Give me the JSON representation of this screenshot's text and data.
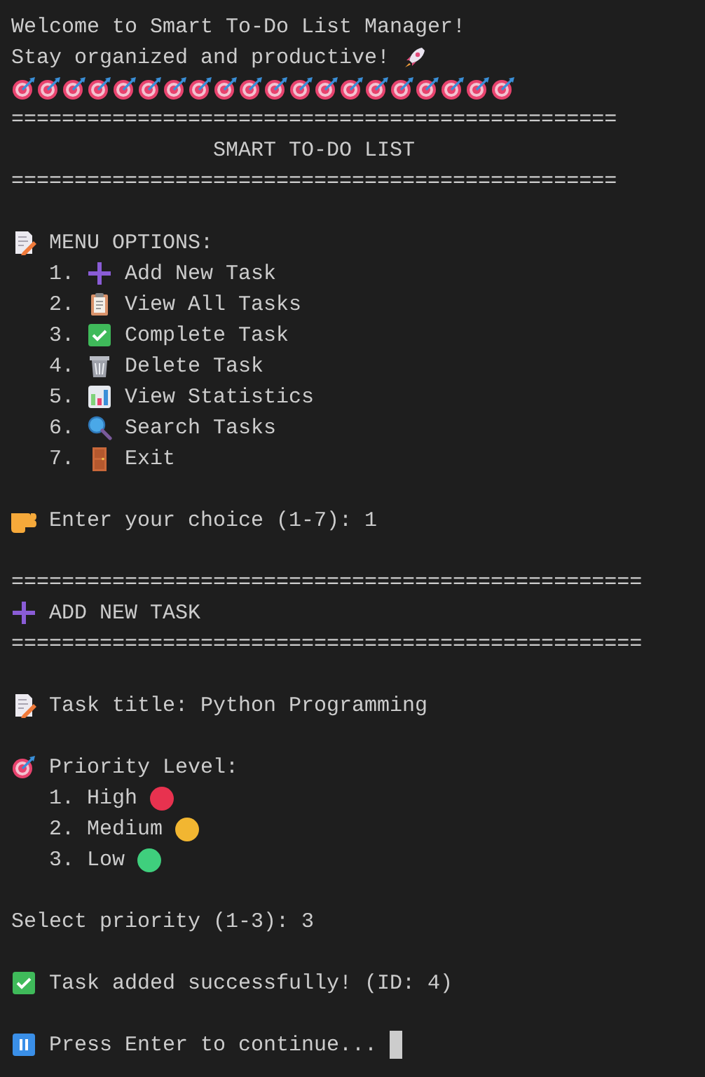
{
  "lines": [
    {
      "kind": "text",
      "text": "Welcome to Smart To-Do List Manager!"
    },
    {
      "kind": "text",
      "text": "Stay organized and productive!",
      "trail": {
        "kind": "rocket"
      }
    },
    {
      "kind": "icons",
      "icons": [
        {
          "kind": "target"
        },
        {
          "kind": "target"
        },
        {
          "kind": "target"
        },
        {
          "kind": "target"
        },
        {
          "kind": "target"
        },
        {
          "kind": "target"
        },
        {
          "kind": "target"
        },
        {
          "kind": "target"
        },
        {
          "kind": "target"
        },
        {
          "kind": "target"
        },
        {
          "kind": "target"
        },
        {
          "kind": "target"
        },
        {
          "kind": "target"
        },
        {
          "kind": "target"
        },
        {
          "kind": "target"
        },
        {
          "kind": "target"
        },
        {
          "kind": "target"
        },
        {
          "kind": "target"
        },
        {
          "kind": "target"
        },
        {
          "kind": "target"
        }
      ]
    },
    {
      "kind": "rule",
      "text": "================================================"
    },
    {
      "kind": "title",
      "text": "SMART TO-DO LIST"
    },
    {
      "kind": "rule",
      "text": "================================================"
    },
    {
      "kind": "blank"
    },
    {
      "kind": "heading",
      "icon": {
        "kind": "memo"
      },
      "text": "MENU OPTIONS:"
    },
    {
      "kind": "menu_item",
      "number": "1.",
      "icon": {
        "kind": "plus"
      },
      "text": "Add New Task"
    },
    {
      "kind": "menu_item",
      "number": "2.",
      "icon": {
        "kind": "clipboard"
      },
      "text": "View All Tasks"
    },
    {
      "kind": "menu_item",
      "number": "3.",
      "icon": {
        "kind": "check"
      },
      "text": "Complete Task"
    },
    {
      "kind": "menu_item",
      "number": "4.",
      "icon": {
        "kind": "trash"
      },
      "text": "Delete Task"
    },
    {
      "kind": "menu_item",
      "number": "5.",
      "icon": {
        "kind": "chart"
      },
      "text": "View Statistics"
    },
    {
      "kind": "menu_item",
      "number": "6.",
      "icon": {
        "kind": "search"
      },
      "text": "Search Tasks"
    },
    {
      "kind": "menu_item",
      "number": "7.",
      "icon": {
        "kind": "door"
      },
      "text": "Exit"
    },
    {
      "kind": "blank"
    },
    {
      "kind": "heading",
      "icon": {
        "kind": "hand"
      },
      "text": "Enter your choice (1-7): 1"
    },
    {
      "kind": "blank"
    },
    {
      "kind": "rule",
      "text": "=================================================="
    },
    {
      "kind": "heading",
      "icon": {
        "kind": "plus"
      },
      "text": "ADD NEW TASK"
    },
    {
      "kind": "rule",
      "text": "=================================================="
    },
    {
      "kind": "blank"
    },
    {
      "kind": "heading",
      "icon": {
        "kind": "memo"
      },
      "text": "Task title: Python Programming"
    },
    {
      "kind": "blank"
    },
    {
      "kind": "heading",
      "icon": {
        "kind": "target"
      },
      "text": "Priority Level:"
    },
    {
      "kind": "option",
      "number": "1.",
      "text": "High",
      "color": "#e8324f"
    },
    {
      "kind": "option",
      "number": "2.",
      "text": "Medium",
      "color": "#f2b631"
    },
    {
      "kind": "option",
      "number": "3.",
      "text": "Low",
      "color": "#3fcf7d"
    },
    {
      "kind": "blank"
    },
    {
      "kind": "text",
      "text": "Select priority (1-3): 3"
    },
    {
      "kind": "blank"
    },
    {
      "kind": "heading",
      "icon": {
        "kind": "check"
      },
      "text": "Task added successfully! (ID: 4)"
    },
    {
      "kind": "blank"
    },
    {
      "kind": "heading",
      "icon": {
        "kind": "pause"
      },
      "text": "Press Enter to continue...",
      "cursor": true
    }
  ]
}
